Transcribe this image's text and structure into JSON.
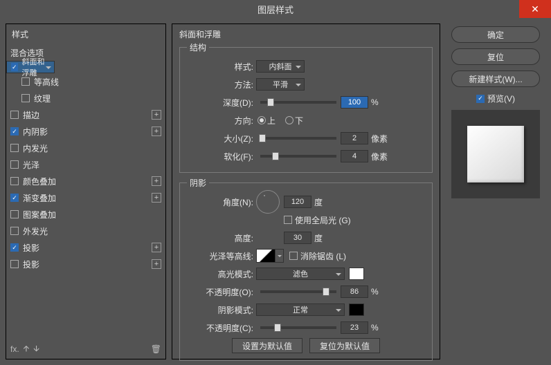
{
  "window": {
    "title": "图层样式"
  },
  "left": {
    "styles_header": "样式",
    "blend_header": "混合选项",
    "items": [
      {
        "label": "斜面和浮雕",
        "checked": true,
        "selected": true,
        "plus": false
      },
      {
        "label": "等高线",
        "checked": false,
        "indent": true,
        "plus": false
      },
      {
        "label": "纹理",
        "checked": false,
        "indent": true,
        "plus": false
      },
      {
        "label": "描边",
        "checked": false,
        "plus": true
      },
      {
        "label": "内阴影",
        "checked": true,
        "plus": true
      },
      {
        "label": "内发光",
        "checked": false,
        "plus": false
      },
      {
        "label": "光泽",
        "checked": false,
        "plus": false
      },
      {
        "label": "颜色叠加",
        "checked": false,
        "plus": true
      },
      {
        "label": "渐变叠加",
        "checked": true,
        "plus": true
      },
      {
        "label": "图案叠加",
        "checked": false,
        "plus": false
      },
      {
        "label": "外发光",
        "checked": false,
        "plus": false
      },
      {
        "label": "投影",
        "checked": true,
        "plus": true
      },
      {
        "label": "投影",
        "checked": false,
        "plus": true
      }
    ]
  },
  "center": {
    "section_title": "斜面和浮雕",
    "structure_legend": "结构",
    "style_lab": "样式:",
    "style_val": "内斜面",
    "tech_lab": "方法:",
    "tech_val": "平滑",
    "depth_lab": "深度(D):",
    "depth_val": "100",
    "depth_unit": "%",
    "dir_lab": "方向:",
    "dir_up": "上",
    "dir_down": "下",
    "size_lab": "大小(Z):",
    "size_val": "2",
    "size_unit": "像素",
    "soften_lab": "软化(F):",
    "soften_val": "4",
    "soften_unit": "像素",
    "shade_legend": "阴影",
    "angle_lab": "角度(N):",
    "angle_val": "120",
    "angle_unit": "度",
    "global_lab": "使用全局光 (G)",
    "alt_lab": "高度:",
    "alt_val": "30",
    "alt_unit": "度",
    "gloss_lab": "光泽等高线:",
    "antialias_lab": "消除锯齿 (L)",
    "hi_mode_lab": "高光模式:",
    "hi_mode_val": "滤色",
    "hi_op_lab": "不透明度(O):",
    "hi_op_val": "86",
    "hi_op_unit": "%",
    "sh_mode_lab": "阴影模式:",
    "sh_mode_val": "正常",
    "sh_op_lab": "不透明度(C):",
    "sh_op_val": "23",
    "sh_op_unit": "%",
    "default_btn": "设置为默认值",
    "reset_btn": "复位为默认值"
  },
  "right": {
    "ok": "确定",
    "cancel": "复位",
    "newstyle": "新建样式(W)...",
    "preview_lab": "预览(V)"
  }
}
